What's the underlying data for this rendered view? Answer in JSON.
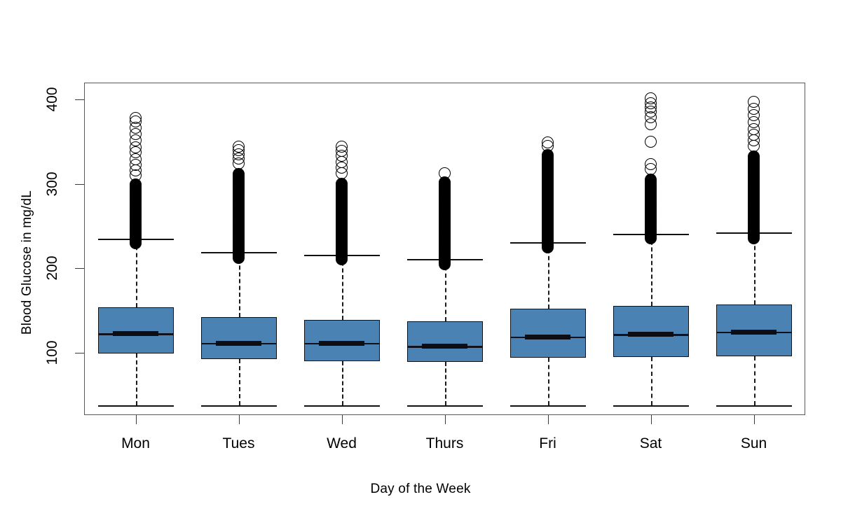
{
  "chart_data": {
    "type": "boxplot",
    "title": "",
    "xlabel": "Day of the Week",
    "ylabel": "Blood Glucose in mg/dL",
    "categories": [
      "Mon",
      "Tues",
      "Wed",
      "Thurs",
      "Fri",
      "Sat",
      "Sun"
    ],
    "ylim": [
      30,
      410
    ],
    "yticks": [
      100,
      200,
      300,
      400
    ],
    "ytick_labels": [
      "100",
      "200",
      "300",
      "400"
    ],
    "grid": false,
    "legend": null,
    "box_fill_color": "#4a82b4",
    "box_line_color": "#111111",
    "outlier_marker": "open-circle",
    "boxes": [
      {
        "category": "Mon",
        "whisker_low": 39,
        "q1": 100,
        "median": 123,
        "q3": 155,
        "whisker_high": 236,
        "outliers_dense_range": [
          236,
          307
        ],
        "outliers_sparse": [
          311,
          317,
          323,
          330,
          338,
          344,
          352,
          360,
          367,
          375,
          379
        ]
      },
      {
        "category": "Tues",
        "whisker_low": 39,
        "q1": 93,
        "median": 112,
        "q3": 143,
        "whisker_high": 220,
        "outliers_dense_range": [
          220,
          320
        ],
        "outliers_sparse": [
          325,
          331,
          336,
          341,
          345
        ]
      },
      {
        "category": "Wed",
        "whisker_low": 39,
        "q1": 91,
        "median": 112,
        "q3": 140,
        "whisker_high": 217,
        "outliers_dense_range": [
          217,
          308
        ],
        "outliers_sparse": [
          313,
          320,
          327,
          334,
          340,
          345
        ]
      },
      {
        "category": "Thurs",
        "whisker_low": 39,
        "q1": 90,
        "median": 108,
        "q3": 138,
        "whisker_high": 212,
        "outliers_dense_range": [
          212,
          310
        ],
        "outliers_sparse": [
          313
        ]
      },
      {
        "category": "Fri",
        "whisker_low": 39,
        "q1": 95,
        "median": 119,
        "q3": 153,
        "whisker_high": 232,
        "outliers_dense_range": [
          232,
          342
        ],
        "outliers_sparse": [
          346,
          350
        ]
      },
      {
        "category": "Sat",
        "whisker_low": 39,
        "q1": 96,
        "median": 122,
        "q3": 156,
        "whisker_high": 242,
        "outliers_dense_range": [
          242,
          313
        ],
        "outliers_sparse": [
          318,
          324,
          351,
          371,
          380,
          386,
          391,
          396,
          402
        ]
      },
      {
        "category": "Sun",
        "whisker_low": 39,
        "q1": 97,
        "median": 125,
        "q3": 158,
        "whisker_high": 243,
        "outliers_dense_range": [
          243,
          340
        ],
        "outliers_sparse": [
          346,
          352,
          359,
          366,
          374,
          382,
          390,
          398
        ]
      }
    ]
  },
  "axes": {
    "x_title": "Day of the Week",
    "y_title": "Blood Glucose in mg/dL"
  }
}
